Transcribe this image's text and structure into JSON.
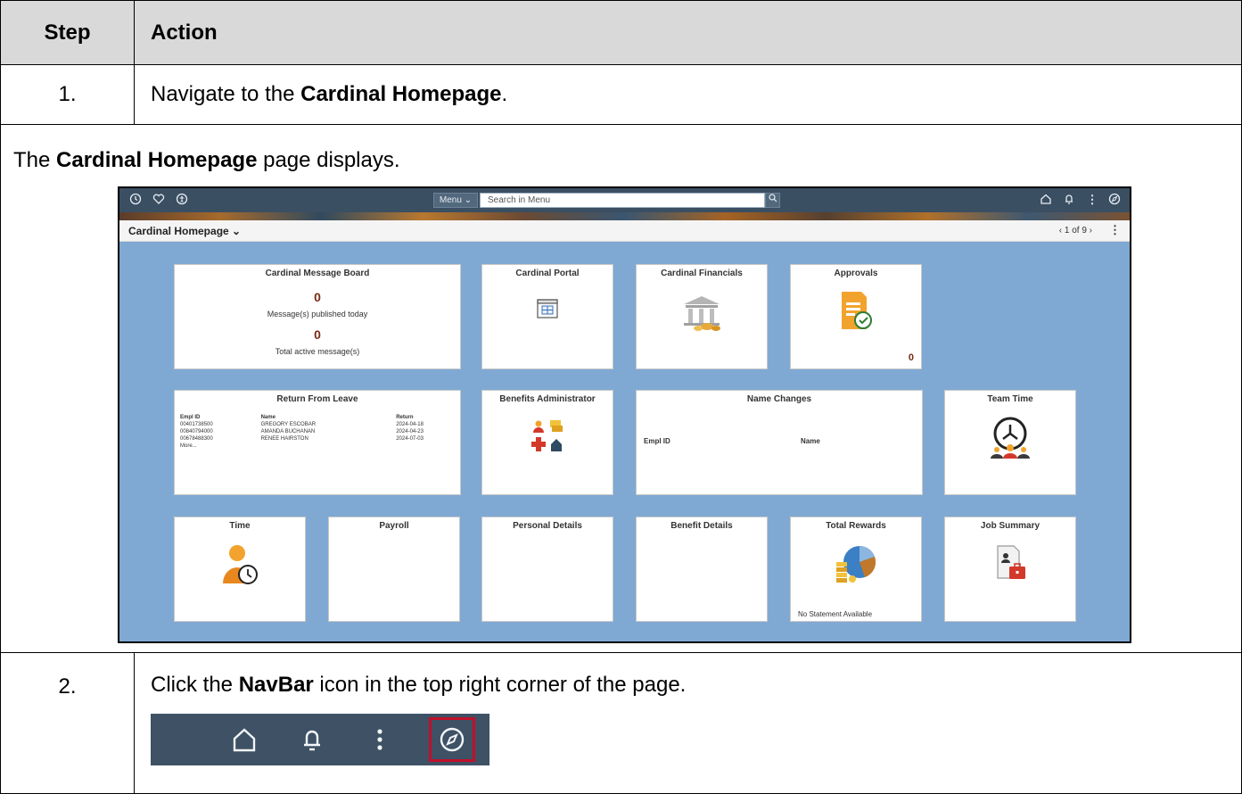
{
  "header": {
    "step": "Step",
    "action": "Action"
  },
  "steps": [
    {
      "number": "1.",
      "text_before": "Navigate to the ",
      "text_bold": "Cardinal Homepage",
      "text_after": "."
    },
    {
      "number": "2.",
      "text_before": "Click the ",
      "text_bold": "NavBar",
      "text_after": " icon in the top right corner of the page."
    }
  ],
  "note": {
    "text_before": "The ",
    "text_bold": "Cardinal Homepage",
    "text_after": " page displays."
  },
  "screenshot": {
    "menu_label": "Menu ⌄",
    "search_placeholder": "Search in Menu",
    "page_title": "Cardinal Homepage ⌄",
    "pager": "‹  1 of 9  ›",
    "tiles": {
      "message_board": {
        "title": "Cardinal Message Board",
        "count_today": "0",
        "label_today": "Message(s) published today",
        "count_active": "0",
        "label_active": "Total active message(s)"
      },
      "portal": {
        "title": "Cardinal Portal"
      },
      "financials": {
        "title": "Cardinal Financials"
      },
      "approvals": {
        "title": "Approvals",
        "count": "0"
      },
      "return_from_leave": {
        "title": "Return From Leave",
        "headers": [
          "Empl ID",
          "Name",
          "Return"
        ],
        "rows": [
          [
            "00401738500",
            "GREGORY ESCOBAR",
            "2024-04-18"
          ],
          [
            "00840794000",
            "AMANDA BUCHANAN",
            "2024-04-23"
          ],
          [
            "00678488300",
            "RENEE HAIRSTON",
            "2024-07-03"
          ]
        ],
        "more": "More..."
      },
      "benefits_admin": {
        "title": "Benefits Administrator"
      },
      "name_changes": {
        "title": "Name Changes",
        "col1": "Empl ID",
        "col2": "Name"
      },
      "team_time": {
        "title": "Team Time"
      },
      "time": {
        "title": "Time"
      },
      "payroll": {
        "title": "Payroll"
      },
      "personal_details": {
        "title": "Personal Details"
      },
      "benefit_details": {
        "title": "Benefit Details"
      },
      "total_rewards": {
        "title": "Total Rewards",
        "status": "No Statement Available"
      },
      "job_summary": {
        "title": "Job Summary"
      }
    }
  },
  "navbar_crop": {
    "icons": [
      "home-icon",
      "bell-icon",
      "kebab-icon",
      "compass-icon"
    ],
    "highlight_color": "#c0102a"
  }
}
